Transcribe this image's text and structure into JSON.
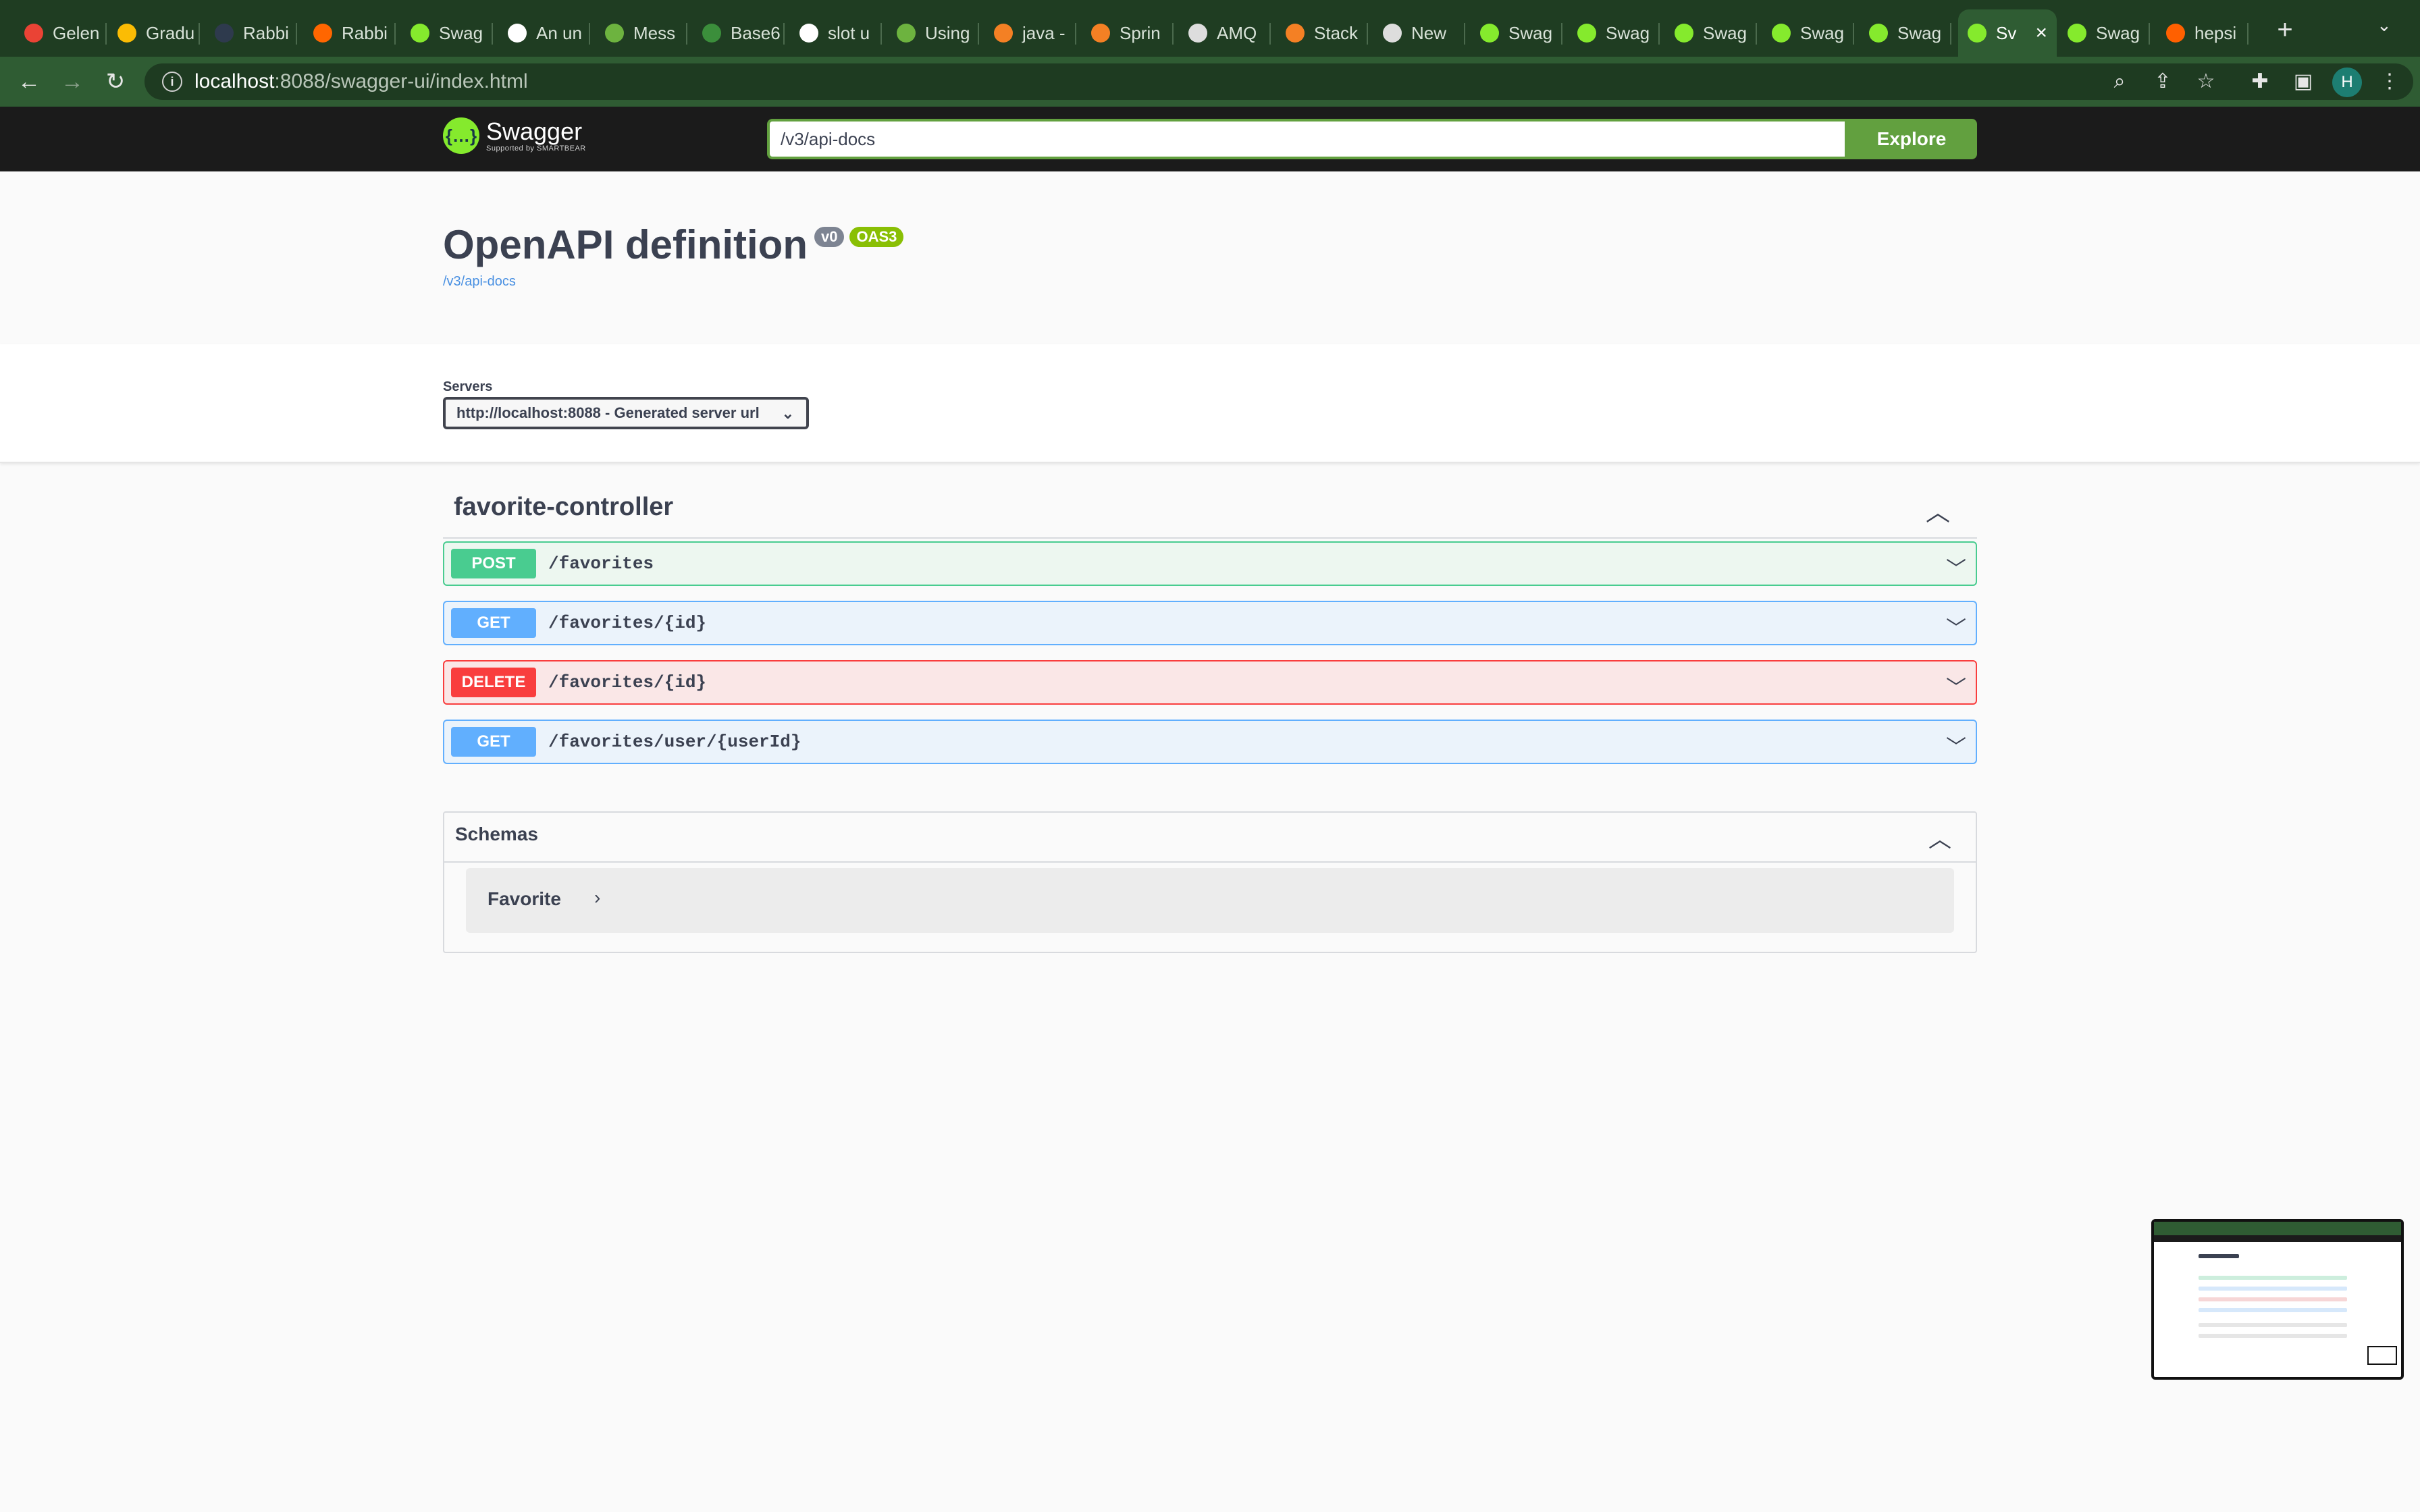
{
  "browser": {
    "tabs": [
      {
        "label": "Gelen",
        "icon": "gmail-icon",
        "color": "#ea4335"
      },
      {
        "label": "Gradu",
        "icon": "drive-icon",
        "color": "#fbbc04"
      },
      {
        "label": "Rabbi",
        "icon": "rabbit-icon",
        "color": "#2e3a4d"
      },
      {
        "label": "Rabbi",
        "icon": "rabbitmq-icon",
        "color": "#ff6600"
      },
      {
        "label": "Swag",
        "icon": "swagger-icon",
        "color": "#85ea2d"
      },
      {
        "label": "An un",
        "icon": "github-icon",
        "color": "#ffffff"
      },
      {
        "label": "Mess",
        "icon": "spring-icon",
        "color": "#6db33f"
      },
      {
        "label": "Base6",
        "icon": "base64-icon",
        "color": "#3b8e3b"
      },
      {
        "label": "slot u",
        "icon": "google-icon",
        "color": "#ffffff"
      },
      {
        "label": "Using",
        "icon": "spring-icon",
        "color": "#6db33f"
      },
      {
        "label": "java -",
        "icon": "stackoverflow-icon",
        "color": "#f48024"
      },
      {
        "label": "Sprin",
        "icon": "stackoverflow-icon",
        "color": "#f48024"
      },
      {
        "label": "AMQ",
        "icon": "globe-icon",
        "color": "#dddddd"
      },
      {
        "label": "Stack",
        "icon": "stackoverflow-icon",
        "color": "#f48024"
      },
      {
        "label": "New",
        "icon": "chrome-icon",
        "color": "#dddddd"
      },
      {
        "label": "Swag",
        "icon": "swagger-icon",
        "color": "#85ea2d"
      },
      {
        "label": "Swag",
        "icon": "swagger-icon",
        "color": "#85ea2d"
      },
      {
        "label": "Swag",
        "icon": "swagger-icon",
        "color": "#85ea2d"
      },
      {
        "label": "Swag",
        "icon": "swagger-icon",
        "color": "#85ea2d"
      },
      {
        "label": "Swag",
        "icon": "swagger-icon",
        "color": "#85ea2d"
      },
      {
        "label": "Sv",
        "icon": "swagger-icon",
        "color": "#85ea2d",
        "active": true
      },
      {
        "label": "Swag",
        "icon": "swagger-icon",
        "color": "#85ea2d"
      },
      {
        "label": "hepsi",
        "icon": "hepsiburada-icon",
        "color": "#ff6000"
      }
    ],
    "address": {
      "host": "localhost",
      "path": ":8088/swagger-ui/index.html"
    },
    "profile_initial": "H"
  },
  "topbar": {
    "brand": "Swagger",
    "sub_brand": "Supported by SMARTBEAR",
    "url_value": "/v3/api-docs",
    "explore_label": "Explore"
  },
  "info": {
    "title": "OpenAPI definition",
    "version_badge": "v0",
    "oas_badge": "OAS3",
    "spec_link": "/v3/api-docs"
  },
  "servers": {
    "label": "Servers",
    "selected": "http://localhost:8088 - Generated server url"
  },
  "controller": {
    "name": "favorite-controller",
    "operations": [
      {
        "method": "POST",
        "path": "/favorites"
      },
      {
        "method": "GET",
        "path": "/favorites/{id}"
      },
      {
        "method": "DELETE",
        "path": "/favorites/{id}"
      },
      {
        "method": "GET",
        "path": "/favorites/user/{userId}"
      }
    ]
  },
  "schemas": {
    "title": "Schemas",
    "items": [
      {
        "name": "Favorite"
      }
    ]
  },
  "colors": {
    "post": "#49cc90",
    "get": "#61affe",
    "delete": "#f93e3e",
    "explore": "#62a03f",
    "tab_strip": "#1f3d22"
  }
}
